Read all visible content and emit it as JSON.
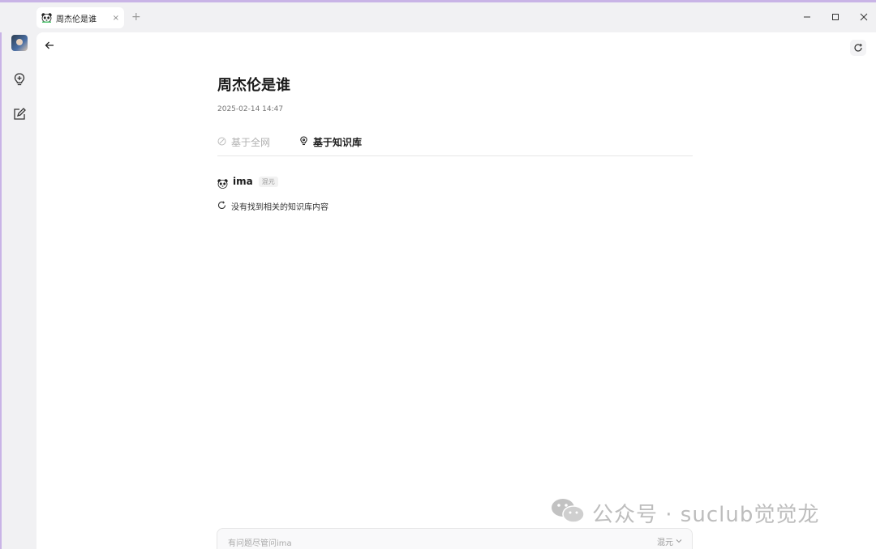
{
  "window": {
    "tab_title": "周杰伦是谁",
    "new_tab_symbol": "+",
    "tab_close_symbol": "×"
  },
  "sidebar": {
    "items": [
      {
        "icon": "avatar"
      },
      {
        "icon": "lightbulb-plus-icon"
      },
      {
        "icon": "edit-icon"
      }
    ]
  },
  "page": {
    "title": "周杰伦是谁",
    "date": "2025-02-14 14:47",
    "tabs": [
      {
        "label": "基于全网",
        "icon": "web-icon",
        "active": false
      },
      {
        "label": "基于知识库",
        "icon": "knowledge-icon",
        "active": true
      }
    ]
  },
  "answer": {
    "name": "ima",
    "model": "混元",
    "status": "没有找到相关的知识库内容"
  },
  "input": {
    "placeholder": "有问题尽管问ima",
    "model": "混元"
  },
  "watermark": {
    "text": "公众号 · suclub觉觉龙"
  },
  "colors": {
    "accent": "#c9b4e6",
    "background": "#f1f1f3",
    "content": "#ffffff"
  }
}
